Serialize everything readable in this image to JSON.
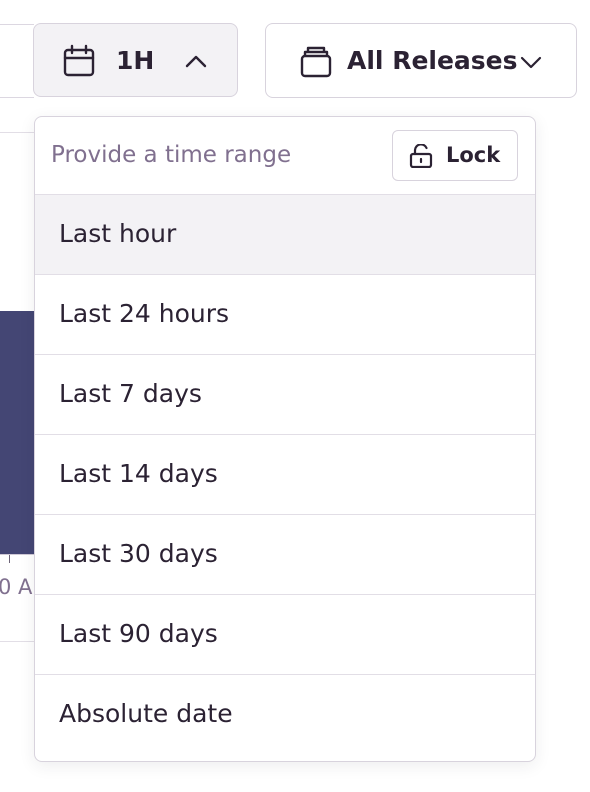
{
  "date_picker": {
    "label": "1H",
    "icon": "calendar-icon",
    "expanded_icon": "chevron-up-icon"
  },
  "release_filter": {
    "label": "All Releases",
    "icon": "stack-icon",
    "dropdown_icon": "chevron-down-icon"
  },
  "time_menu": {
    "placeholder": "Provide a time range",
    "lock_label": "Lock",
    "lock_icon": "unlock-icon",
    "options": [
      {
        "label": "Last hour",
        "selected": true
      },
      {
        "label": "Last 24 hours",
        "selected": false
      },
      {
        "label": "Last 7 days",
        "selected": false
      },
      {
        "label": "Last 14 days",
        "selected": false
      },
      {
        "label": "Last 30 days",
        "selected": false
      },
      {
        "label": "Last 90 days",
        "selected": false
      },
      {
        "label": "Absolute date",
        "selected": false
      }
    ]
  },
  "background": {
    "axis_tick_label": "0 A",
    "bar_color": "#444674"
  },
  "colors": {
    "text_primary": "#2b2233",
    "text_muted": "#80708f",
    "border": "#d8d3dd",
    "active_bg": "#f3f2f5"
  }
}
